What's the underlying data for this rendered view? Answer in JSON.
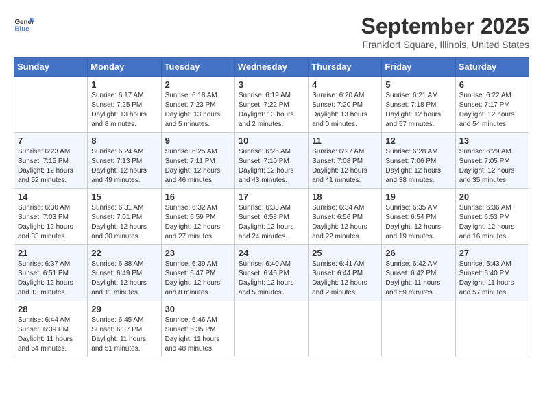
{
  "header": {
    "logo_general": "General",
    "logo_blue": "Blue",
    "month": "September 2025",
    "location": "Frankfort Square, Illinois, United States"
  },
  "days_of_week": [
    "Sunday",
    "Monday",
    "Tuesday",
    "Wednesday",
    "Thursday",
    "Friday",
    "Saturday"
  ],
  "weeks": [
    [
      {
        "day": "",
        "sunrise": "",
        "sunset": "",
        "daylight": ""
      },
      {
        "day": "1",
        "sunrise": "Sunrise: 6:17 AM",
        "sunset": "Sunset: 7:25 PM",
        "daylight": "Daylight: 13 hours and 8 minutes."
      },
      {
        "day": "2",
        "sunrise": "Sunrise: 6:18 AM",
        "sunset": "Sunset: 7:23 PM",
        "daylight": "Daylight: 13 hours and 5 minutes."
      },
      {
        "day": "3",
        "sunrise": "Sunrise: 6:19 AM",
        "sunset": "Sunset: 7:22 PM",
        "daylight": "Daylight: 13 hours and 2 minutes."
      },
      {
        "day": "4",
        "sunrise": "Sunrise: 6:20 AM",
        "sunset": "Sunset: 7:20 PM",
        "daylight": "Daylight: 13 hours and 0 minutes."
      },
      {
        "day": "5",
        "sunrise": "Sunrise: 6:21 AM",
        "sunset": "Sunset: 7:18 PM",
        "daylight": "Daylight: 12 hours and 57 minutes."
      },
      {
        "day": "6",
        "sunrise": "Sunrise: 6:22 AM",
        "sunset": "Sunset: 7:17 PM",
        "daylight": "Daylight: 12 hours and 54 minutes."
      }
    ],
    [
      {
        "day": "7",
        "sunrise": "Sunrise: 6:23 AM",
        "sunset": "Sunset: 7:15 PM",
        "daylight": "Daylight: 12 hours and 52 minutes."
      },
      {
        "day": "8",
        "sunrise": "Sunrise: 6:24 AM",
        "sunset": "Sunset: 7:13 PM",
        "daylight": "Daylight: 12 hours and 49 minutes."
      },
      {
        "day": "9",
        "sunrise": "Sunrise: 6:25 AM",
        "sunset": "Sunset: 7:11 PM",
        "daylight": "Daylight: 12 hours and 46 minutes."
      },
      {
        "day": "10",
        "sunrise": "Sunrise: 6:26 AM",
        "sunset": "Sunset: 7:10 PM",
        "daylight": "Daylight: 12 hours and 43 minutes."
      },
      {
        "day": "11",
        "sunrise": "Sunrise: 6:27 AM",
        "sunset": "Sunset: 7:08 PM",
        "daylight": "Daylight: 12 hours and 41 minutes."
      },
      {
        "day": "12",
        "sunrise": "Sunrise: 6:28 AM",
        "sunset": "Sunset: 7:06 PM",
        "daylight": "Daylight: 12 hours and 38 minutes."
      },
      {
        "day": "13",
        "sunrise": "Sunrise: 6:29 AM",
        "sunset": "Sunset: 7:05 PM",
        "daylight": "Daylight: 12 hours and 35 minutes."
      }
    ],
    [
      {
        "day": "14",
        "sunrise": "Sunrise: 6:30 AM",
        "sunset": "Sunset: 7:03 PM",
        "daylight": "Daylight: 12 hours and 33 minutes."
      },
      {
        "day": "15",
        "sunrise": "Sunrise: 6:31 AM",
        "sunset": "Sunset: 7:01 PM",
        "daylight": "Daylight: 12 hours and 30 minutes."
      },
      {
        "day": "16",
        "sunrise": "Sunrise: 6:32 AM",
        "sunset": "Sunset: 6:59 PM",
        "daylight": "Daylight: 12 hours and 27 minutes."
      },
      {
        "day": "17",
        "sunrise": "Sunrise: 6:33 AM",
        "sunset": "Sunset: 6:58 PM",
        "daylight": "Daylight: 12 hours and 24 minutes."
      },
      {
        "day": "18",
        "sunrise": "Sunrise: 6:34 AM",
        "sunset": "Sunset: 6:56 PM",
        "daylight": "Daylight: 12 hours and 22 minutes."
      },
      {
        "day": "19",
        "sunrise": "Sunrise: 6:35 AM",
        "sunset": "Sunset: 6:54 PM",
        "daylight": "Daylight: 12 hours and 19 minutes."
      },
      {
        "day": "20",
        "sunrise": "Sunrise: 6:36 AM",
        "sunset": "Sunset: 6:53 PM",
        "daylight": "Daylight: 12 hours and 16 minutes."
      }
    ],
    [
      {
        "day": "21",
        "sunrise": "Sunrise: 6:37 AM",
        "sunset": "Sunset: 6:51 PM",
        "daylight": "Daylight: 12 hours and 13 minutes."
      },
      {
        "day": "22",
        "sunrise": "Sunrise: 6:38 AM",
        "sunset": "Sunset: 6:49 PM",
        "daylight": "Daylight: 12 hours and 11 minutes."
      },
      {
        "day": "23",
        "sunrise": "Sunrise: 6:39 AM",
        "sunset": "Sunset: 6:47 PM",
        "daylight": "Daylight: 12 hours and 8 minutes."
      },
      {
        "day": "24",
        "sunrise": "Sunrise: 6:40 AM",
        "sunset": "Sunset: 6:46 PM",
        "daylight": "Daylight: 12 hours and 5 minutes."
      },
      {
        "day": "25",
        "sunrise": "Sunrise: 6:41 AM",
        "sunset": "Sunset: 6:44 PM",
        "daylight": "Daylight: 12 hours and 2 minutes."
      },
      {
        "day": "26",
        "sunrise": "Sunrise: 6:42 AM",
        "sunset": "Sunset: 6:42 PM",
        "daylight": "Daylight: 11 hours and 59 minutes."
      },
      {
        "day": "27",
        "sunrise": "Sunrise: 6:43 AM",
        "sunset": "Sunset: 6:40 PM",
        "daylight": "Daylight: 11 hours and 57 minutes."
      }
    ],
    [
      {
        "day": "28",
        "sunrise": "Sunrise: 6:44 AM",
        "sunset": "Sunset: 6:39 PM",
        "daylight": "Daylight: 11 hours and 54 minutes."
      },
      {
        "day": "29",
        "sunrise": "Sunrise: 6:45 AM",
        "sunset": "Sunset: 6:37 PM",
        "daylight": "Daylight: 11 hours and 51 minutes."
      },
      {
        "day": "30",
        "sunrise": "Sunrise: 6:46 AM",
        "sunset": "Sunset: 6:35 PM",
        "daylight": "Daylight: 11 hours and 48 minutes."
      },
      {
        "day": "",
        "sunrise": "",
        "sunset": "",
        "daylight": ""
      },
      {
        "day": "",
        "sunrise": "",
        "sunset": "",
        "daylight": ""
      },
      {
        "day": "",
        "sunrise": "",
        "sunset": "",
        "daylight": ""
      },
      {
        "day": "",
        "sunrise": "",
        "sunset": "",
        "daylight": ""
      }
    ]
  ]
}
